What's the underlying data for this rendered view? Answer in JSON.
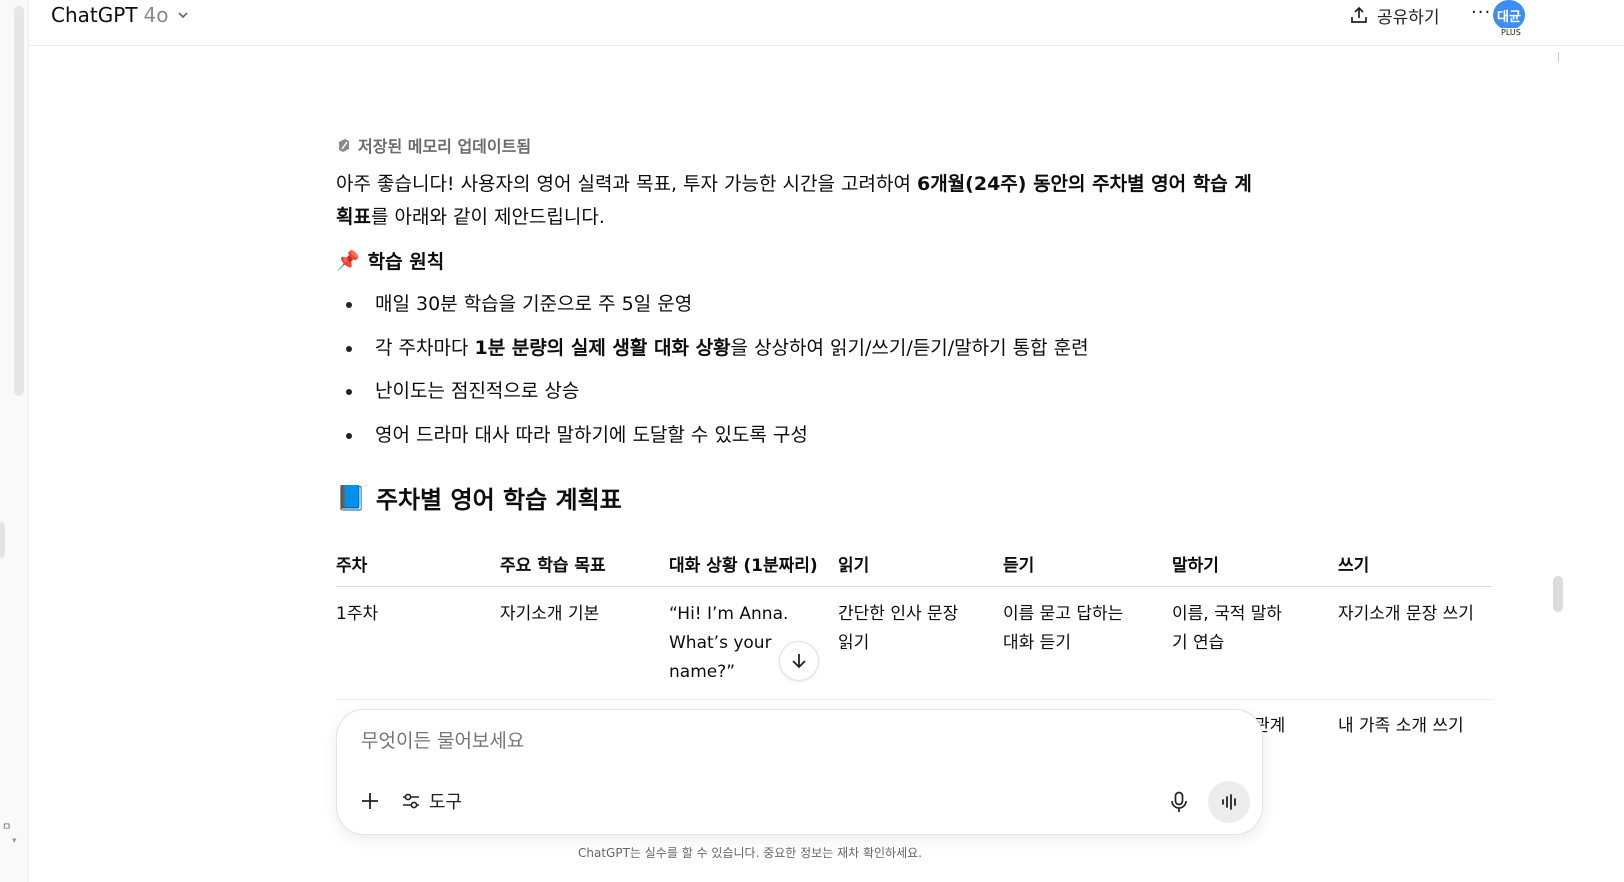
{
  "header": {
    "app_name": "ChatGPT",
    "model": "4o",
    "share_label": "공유하기",
    "more_label": "···",
    "avatar_initials": "대균",
    "plan_badge": "PLUS"
  },
  "message": {
    "memory_notice": "저장된 메모리 업데이트됨",
    "intro_1": "아주 좋습니다! 사용자의 영어 실력과 목표, 투자 가능한 시간을 고려하여 ",
    "intro_bold_1": "6개월(24주) 동안의 주차별 영어 학습 계획표",
    "intro_2": "를 아래와 같이 제안드립니다.",
    "principles_emoji": "📌",
    "principles_title": "학습 원칙",
    "bullets": [
      {
        "pre": "매일 30분 학습을 기준으로 주 5일 운영",
        "bold": "",
        "post": ""
      },
      {
        "pre": "각 주차마다 ",
        "bold": "1분 분량의 실제 생활 대화 상황",
        "post": "을 상상하여 읽기/쓰기/듣기/말하기 통합 훈련"
      },
      {
        "pre": "난이도는 점진적으로 상승",
        "bold": "",
        "post": ""
      },
      {
        "pre": "영어 드라마 대사 따라 말하기에 도달할 수 있도록 구성",
        "bold": "",
        "post": ""
      }
    ],
    "table_emoji": "📘",
    "table_title": "주차별 영어 학습 계획표"
  },
  "table": {
    "headers": [
      "주차",
      "주요 학습 목표",
      "대화 상황 (1분짜리)",
      "읽기",
      "듣기",
      "말하기",
      "쓰기"
    ],
    "rows": [
      [
        "1주차",
        "자기소개 기본",
        "“Hi! I’m Anna. What’s your name?”",
        "간단한 인사 문장 읽기",
        "이름 묻고 답하는 대화 듣기",
        "이름, 국적 말하기 연습",
        "자기소개 문장 쓰기"
      ]
    ],
    "row2_partial": {
      "col6": "관계",
      "col7": "내 가족 소개 쓰기"
    }
  },
  "composer": {
    "placeholder": "무엇이든 물어보세요",
    "tools_label": "도구"
  },
  "footer": {
    "disclaimer": "ChatGPT는 실수를 할 수 있습니다. 중요한 정보는 재차 확인하세요."
  }
}
